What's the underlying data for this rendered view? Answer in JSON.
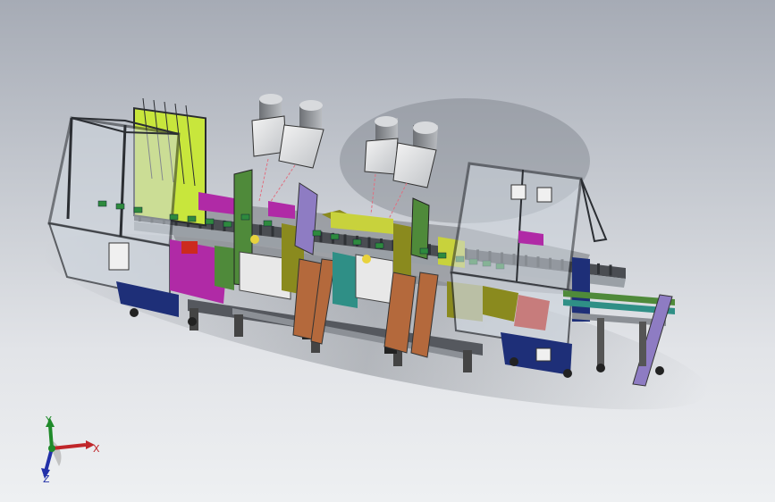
{
  "viewport": {
    "background_top": "#a6abb5",
    "background_bottom": "#eef0f2"
  },
  "model": {
    "frame_color": "#3a3d42",
    "glass_color": "#cfd6de",
    "accent_colors": {
      "yellow_green": "#c8e63c",
      "magenta": "#b02aa6",
      "olive": "#8a8a1e",
      "green": "#4f8a3a",
      "navy": "#1e2f78",
      "lavender": "#8e7cc3",
      "copper": "#b4693c",
      "teal": "#2f8f86"
    }
  },
  "triad": {
    "x_label": "X",
    "y_label": "Y",
    "z_label": "Z",
    "x_color": "#c0262a",
    "y_color": "#1f8a2a",
    "z_color": "#2230a8"
  }
}
